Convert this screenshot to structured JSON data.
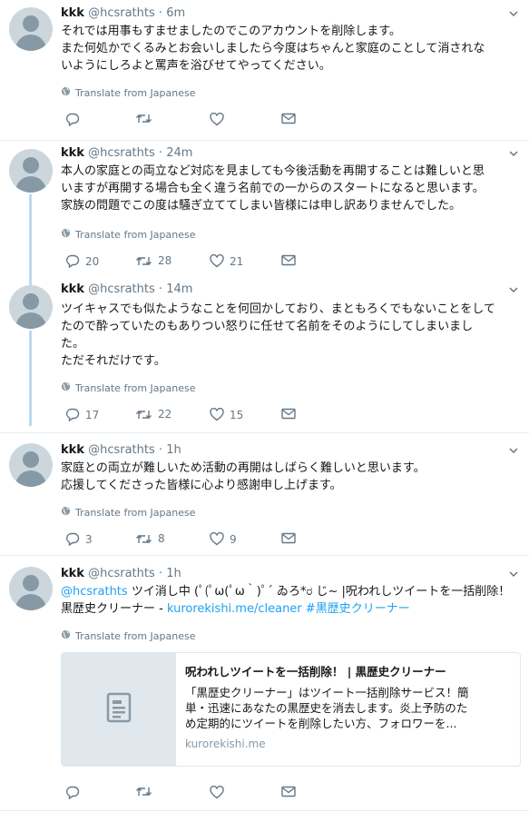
{
  "colors": {
    "accent": "#1da1f2",
    "muted": "#657786",
    "thread_line": "#b8dbf3",
    "border": "#e6ecf0"
  },
  "tweets": [
    {
      "name": "kkk",
      "handle": "@hcsrathts",
      "sep": "·",
      "time": "6m",
      "lines": [
        "それでは用事もすませましたのでこのアカウントを削除します。",
        "また何処かでくるみとお会いしましたら今度はちゃんと家庭のことして消されな",
        "いようにしろよと罵声を浴びせてやってください。"
      ],
      "translate": "Translate from Japanese",
      "replies": "",
      "retweets": "",
      "likes": ""
    },
    {
      "name": "kkk",
      "handle": "@hcsrathts",
      "sep": "·",
      "time": "24m",
      "lines": [
        "本人の家庭との両立など対応を見ましても今後活動を再開することは難しいと思",
        "いますが再開する場合も全く違う名前での一からのスタートになると思います。",
        "家族の問題でこの度は騒ぎ立ててしまい皆様には申し訳ありませんでした。"
      ],
      "translate": "Translate from Japanese",
      "replies": "20",
      "retweets": "28",
      "likes": "21"
    },
    {
      "name": "kkk",
      "handle": "@hcsrathts",
      "sep": "·",
      "time": "14m",
      "lines": [
        "ツイキャスでも似たようなことを何回かしており、まともろくでもないことをして",
        "たので酔っていたのもありつい怒りに任せて名前をそのようにしてしまいまし",
        "た。",
        "ただそれだけです。"
      ],
      "translate": "Translate from Japanese",
      "replies": "17",
      "retweets": "22",
      "likes": "15"
    },
    {
      "name": "kkk",
      "handle": "@hcsrathts",
      "sep": "·",
      "time": "1h",
      "lines": [
        "家庭との両立が難しいため活動の再開はしばらく難しいと思います。",
        "応援してくださった皆様に心より感謝申し上げます。"
      ],
      "translate": "Translate from Japanese",
      "replies": "3",
      "retweets": "8",
      "likes": "9"
    },
    {
      "name": "kkk",
      "handle": "@hcsrathts",
      "sep": "·",
      "time": "1h",
      "mention": "@hcsrathts",
      "line1_rest": " ツイ消し中 (ﾟ(ﾟω(ﾟω｀)ﾟ´ ゐろ*ರ じ~ |呪われしツイートを一括削除！",
      "line2_prefix": "黒歴史クリーナー - ",
      "url": "kurorekishi.me/cleaner",
      "hashtag": "#黒歴史クリーナー",
      "translate": "Translate from Japanese",
      "card": {
        "title": "呪われしツイートを一括削除！ | 黒歴史クリーナー",
        "desc": [
          "「黒歴史クリーナー」はツイート一括削除サービス！簡",
          "単・迅速にあなたの黒歴史を消去します。炎上予防のた",
          "め定期的にツイートを削除したい方、フォロワーを..."
        ],
        "domain": "kurorekishi.me",
        "thumb_icon": "document-icon"
      },
      "replies": "",
      "retweets": "",
      "likes": ""
    }
  ]
}
